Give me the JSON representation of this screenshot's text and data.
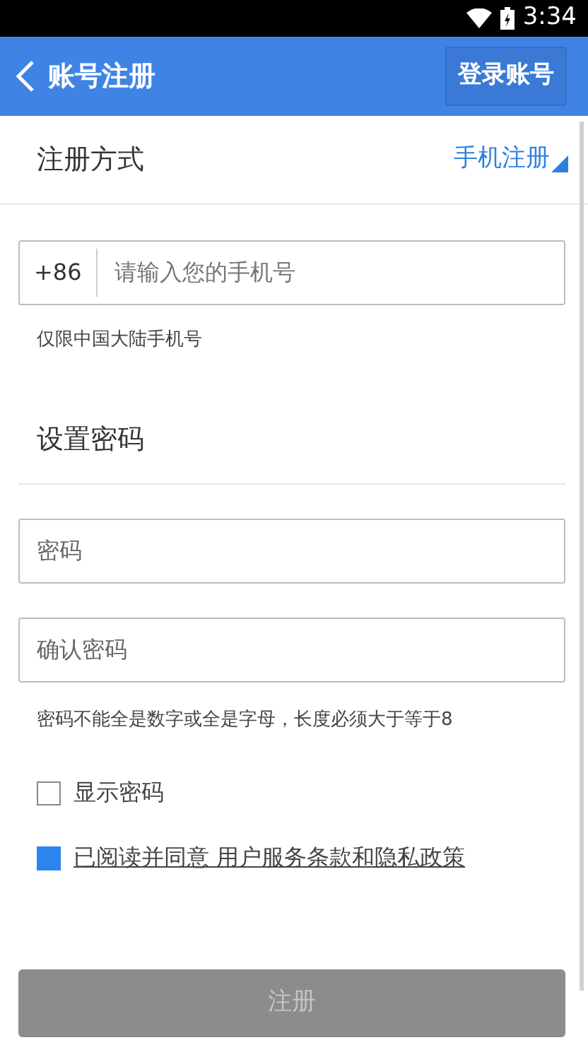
{
  "status_bar": {
    "time": "3:34"
  },
  "header": {
    "title": "账号注册",
    "action": "登录账号"
  },
  "method": {
    "label": "注册方式",
    "value": "手机注册"
  },
  "phone": {
    "prefix": "+86",
    "placeholder": "请输入您的手机号",
    "hint": "仅限中国大陆手机号"
  },
  "password_section": {
    "title": "设置密码"
  },
  "fields": [
    {
      "placeholder": "密码"
    },
    {
      "placeholder": "确认密码"
    }
  ],
  "password_hint": "密码不能全是数字或全是字母，长度必须大于等于8",
  "options": [
    {
      "label": "显示密码",
      "checked": false,
      "kind": "plain"
    },
    {
      "label": "已阅读并同意 用户服务条款和隐私政策",
      "checked": true,
      "kind": "link"
    }
  ],
  "submit": {
    "label": "注册",
    "disabled": true
  }
}
